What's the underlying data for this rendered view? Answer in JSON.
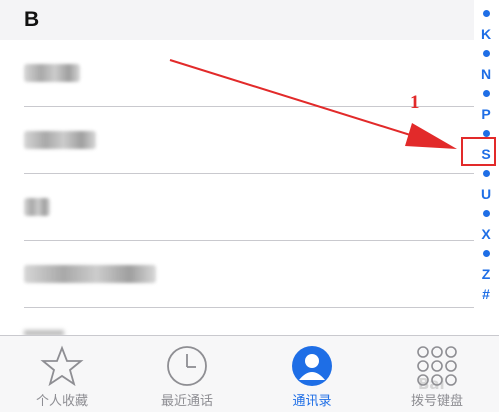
{
  "section": {
    "header": "B"
  },
  "contacts": [
    {
      "name_redacted": true
    },
    {
      "name_redacted": true
    },
    {
      "name_redacted": true
    },
    {
      "name_redacted": true
    }
  ],
  "index_bar": {
    "letters": [
      "K",
      "N",
      "P",
      "S",
      "U",
      "X",
      "Z",
      "#"
    ],
    "highlighted_letter": "S",
    "color": "#1e6ee6"
  },
  "annotation": {
    "number": "1",
    "color": "#e22a2a"
  },
  "tab_bar": {
    "tabs": [
      {
        "label": "个人收藏",
        "icon": "star-icon",
        "active": false
      },
      {
        "label": "最近通话",
        "icon": "clock-icon",
        "active": false
      },
      {
        "label": "通讯录",
        "icon": "contacts-icon",
        "active": true
      },
      {
        "label": "拨号键盘",
        "icon": "keypad-icon",
        "active": false
      }
    ]
  },
  "watermark": {
    "text": "Bai"
  }
}
